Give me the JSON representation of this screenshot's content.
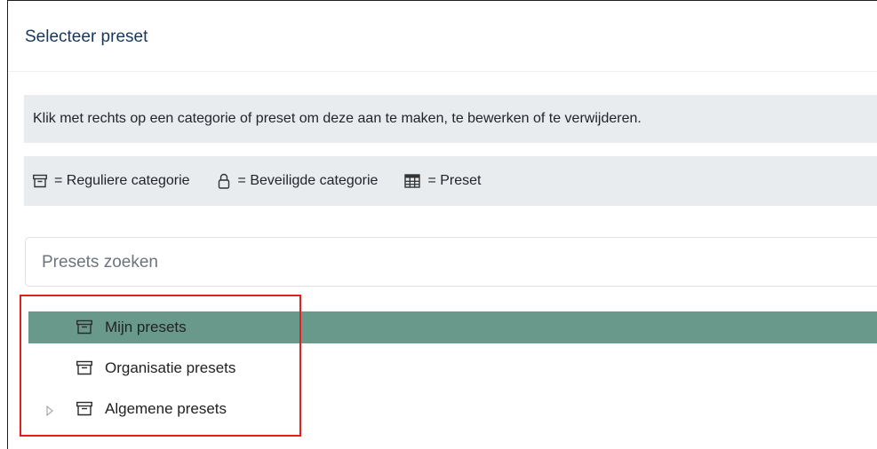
{
  "dialog": {
    "title": "Selecteer preset"
  },
  "info": {
    "text": "Klik met rechts op een categorie of preset om deze aan te maken, te bewerken of te verwijderen."
  },
  "legend": {
    "items": [
      {
        "icon": "archive-icon",
        "label": "= Reguliere categorie"
      },
      {
        "icon": "lock-icon",
        "label": "= Beveiligde categorie"
      },
      {
        "icon": "table-icon",
        "label": "= Preset"
      }
    ]
  },
  "search": {
    "placeholder": "Presets zoeken",
    "value": ""
  },
  "tree": {
    "items": [
      {
        "icon": "archive-icon",
        "label": "Mijn presets",
        "selected": true,
        "expandable": false
      },
      {
        "icon": "archive-icon",
        "label": "Organisatie presets",
        "selected": false,
        "expandable": false
      },
      {
        "icon": "archive-icon",
        "label": "Algemene presets",
        "selected": false,
        "expandable": true
      }
    ]
  },
  "colors": {
    "selected_row": "#68998b",
    "info_bg": "#e9ecef",
    "title_text": "#17375e",
    "highlight_border": "#e0201a"
  }
}
